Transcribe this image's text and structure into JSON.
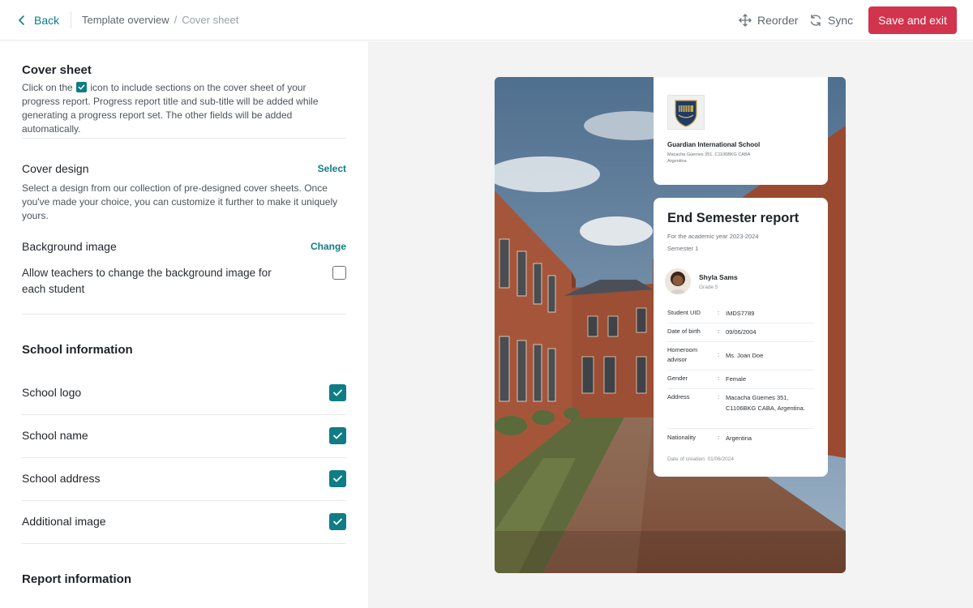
{
  "header": {
    "back_label": "Back",
    "breadcrumb": [
      "Template overview",
      "Cover sheet"
    ],
    "breadcrumb_separator": "/",
    "reorder_label": "Reorder",
    "sync_label": "Sync",
    "save_label": "Save and exit",
    "save_color": "#d2334d",
    "accent_color": "#0f7c86"
  },
  "sidebar": {
    "title": "Cover sheet",
    "intro_before": "Click on the",
    "intro_after": "icon to include sections on the cover sheet of your progress report. Progress report title and sub-title will be added while generating a progress report set. The other fields will be added automatically.",
    "cover_design": {
      "title": "Cover design",
      "action": "Select",
      "description": "Select a design from our collection of pre-designed cover sheets. Once you've made your choice, you can customize it further to make it uniquely yours."
    },
    "background_image": {
      "title": "Background image",
      "action": "Change",
      "allow_label": "Allow teachers to change the background image for each student",
      "allow_checked": false
    },
    "school_information": {
      "title": "School information",
      "items": [
        {
          "label": "School logo",
          "checked": true
        },
        {
          "label": "School name",
          "checked": true
        },
        {
          "label": "School address",
          "checked": true
        },
        {
          "label": "Additional image",
          "checked": true
        }
      ]
    },
    "report_information": {
      "title": "Report information"
    }
  },
  "preview": {
    "school": {
      "name": "Guardian International School",
      "address_line1": "Macacha Güemes 351, C1106BKG CABA",
      "address_line2": "Argentina"
    },
    "report": {
      "title": "End Semester report",
      "academic_year": "For the academic year 2023-2024",
      "semester": "Semester 1"
    },
    "student": {
      "name": "Shyla Sams",
      "grade": "Grade 5"
    },
    "fields": [
      {
        "key": "Student UID",
        "value": "IMDS7789"
      },
      {
        "key": "Date of birth",
        "value": "09/06/2004"
      },
      {
        "key": "Homeroom advisor",
        "value": "Ms. Joan Doe"
      },
      {
        "key": "Gender",
        "value": "Female"
      },
      {
        "key": "Address",
        "value": "Macacha Güemes 351, C1106BKG CABA, Argentina."
      },
      {
        "key": "Nationality",
        "value": "Argentina"
      }
    ],
    "field_separator": ":",
    "date_of_creation": "Date of creation: 01/06/2024"
  }
}
